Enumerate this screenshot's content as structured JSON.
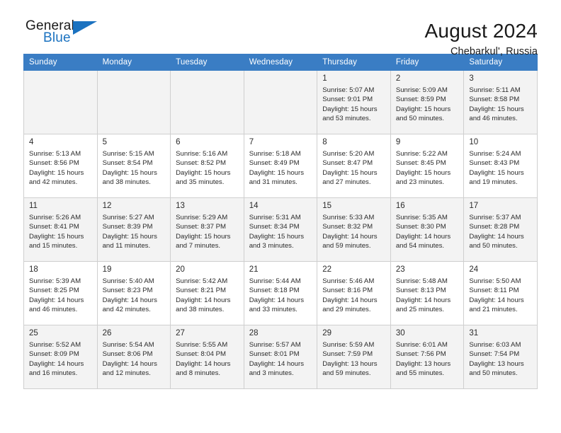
{
  "brand": {
    "name_part1": "General",
    "name_part2": "Blue",
    "accent_color": "#1b72c0"
  },
  "header": {
    "title": "August 2024",
    "subtitle": "Chebarkul', Russia"
  },
  "calendar": {
    "header_color": "#3a7dc4",
    "weekday_headers": [
      "Sunday",
      "Monday",
      "Tuesday",
      "Wednesday",
      "Thursday",
      "Friday",
      "Saturday"
    ],
    "weeks": [
      [
        {
          "day": "",
          "sunrise": "",
          "sunset": "",
          "daylight_line1": "",
          "daylight_line2": ""
        },
        {
          "day": "",
          "sunrise": "",
          "sunset": "",
          "daylight_line1": "",
          "daylight_line2": ""
        },
        {
          "day": "",
          "sunrise": "",
          "sunset": "",
          "daylight_line1": "",
          "daylight_line2": ""
        },
        {
          "day": "",
          "sunrise": "",
          "sunset": "",
          "daylight_line1": "",
          "daylight_line2": ""
        },
        {
          "day": "1",
          "sunrise": "Sunrise: 5:07 AM",
          "sunset": "Sunset: 9:01 PM",
          "daylight_line1": "Daylight: 15 hours",
          "daylight_line2": "and 53 minutes."
        },
        {
          "day": "2",
          "sunrise": "Sunrise: 5:09 AM",
          "sunset": "Sunset: 8:59 PM",
          "daylight_line1": "Daylight: 15 hours",
          "daylight_line2": "and 50 minutes."
        },
        {
          "day": "3",
          "sunrise": "Sunrise: 5:11 AM",
          "sunset": "Sunset: 8:58 PM",
          "daylight_line1": "Daylight: 15 hours",
          "daylight_line2": "and 46 minutes."
        }
      ],
      [
        {
          "day": "4",
          "sunrise": "Sunrise: 5:13 AM",
          "sunset": "Sunset: 8:56 PM",
          "daylight_line1": "Daylight: 15 hours",
          "daylight_line2": "and 42 minutes."
        },
        {
          "day": "5",
          "sunrise": "Sunrise: 5:15 AM",
          "sunset": "Sunset: 8:54 PM",
          "daylight_line1": "Daylight: 15 hours",
          "daylight_line2": "and 38 minutes."
        },
        {
          "day": "6",
          "sunrise": "Sunrise: 5:16 AM",
          "sunset": "Sunset: 8:52 PM",
          "daylight_line1": "Daylight: 15 hours",
          "daylight_line2": "and 35 minutes."
        },
        {
          "day": "7",
          "sunrise": "Sunrise: 5:18 AM",
          "sunset": "Sunset: 8:49 PM",
          "daylight_line1": "Daylight: 15 hours",
          "daylight_line2": "and 31 minutes."
        },
        {
          "day": "8",
          "sunrise": "Sunrise: 5:20 AM",
          "sunset": "Sunset: 8:47 PM",
          "daylight_line1": "Daylight: 15 hours",
          "daylight_line2": "and 27 minutes."
        },
        {
          "day": "9",
          "sunrise": "Sunrise: 5:22 AM",
          "sunset": "Sunset: 8:45 PM",
          "daylight_line1": "Daylight: 15 hours",
          "daylight_line2": "and 23 minutes."
        },
        {
          "day": "10",
          "sunrise": "Sunrise: 5:24 AM",
          "sunset": "Sunset: 8:43 PM",
          "daylight_line1": "Daylight: 15 hours",
          "daylight_line2": "and 19 minutes."
        }
      ],
      [
        {
          "day": "11",
          "sunrise": "Sunrise: 5:26 AM",
          "sunset": "Sunset: 8:41 PM",
          "daylight_line1": "Daylight: 15 hours",
          "daylight_line2": "and 15 minutes."
        },
        {
          "day": "12",
          "sunrise": "Sunrise: 5:27 AM",
          "sunset": "Sunset: 8:39 PM",
          "daylight_line1": "Daylight: 15 hours",
          "daylight_line2": "and 11 minutes."
        },
        {
          "day": "13",
          "sunrise": "Sunrise: 5:29 AM",
          "sunset": "Sunset: 8:37 PM",
          "daylight_line1": "Daylight: 15 hours",
          "daylight_line2": "and 7 minutes."
        },
        {
          "day": "14",
          "sunrise": "Sunrise: 5:31 AM",
          "sunset": "Sunset: 8:34 PM",
          "daylight_line1": "Daylight: 15 hours",
          "daylight_line2": "and 3 minutes."
        },
        {
          "day": "15",
          "sunrise": "Sunrise: 5:33 AM",
          "sunset": "Sunset: 8:32 PM",
          "daylight_line1": "Daylight: 14 hours",
          "daylight_line2": "and 59 minutes."
        },
        {
          "day": "16",
          "sunrise": "Sunrise: 5:35 AM",
          "sunset": "Sunset: 8:30 PM",
          "daylight_line1": "Daylight: 14 hours",
          "daylight_line2": "and 54 minutes."
        },
        {
          "day": "17",
          "sunrise": "Sunrise: 5:37 AM",
          "sunset": "Sunset: 8:28 PM",
          "daylight_line1": "Daylight: 14 hours",
          "daylight_line2": "and 50 minutes."
        }
      ],
      [
        {
          "day": "18",
          "sunrise": "Sunrise: 5:39 AM",
          "sunset": "Sunset: 8:25 PM",
          "daylight_line1": "Daylight: 14 hours",
          "daylight_line2": "and 46 minutes."
        },
        {
          "day": "19",
          "sunrise": "Sunrise: 5:40 AM",
          "sunset": "Sunset: 8:23 PM",
          "daylight_line1": "Daylight: 14 hours",
          "daylight_line2": "and 42 minutes."
        },
        {
          "day": "20",
          "sunrise": "Sunrise: 5:42 AM",
          "sunset": "Sunset: 8:21 PM",
          "daylight_line1": "Daylight: 14 hours",
          "daylight_line2": "and 38 minutes."
        },
        {
          "day": "21",
          "sunrise": "Sunrise: 5:44 AM",
          "sunset": "Sunset: 8:18 PM",
          "daylight_line1": "Daylight: 14 hours",
          "daylight_line2": "and 33 minutes."
        },
        {
          "day": "22",
          "sunrise": "Sunrise: 5:46 AM",
          "sunset": "Sunset: 8:16 PM",
          "daylight_line1": "Daylight: 14 hours",
          "daylight_line2": "and 29 minutes."
        },
        {
          "day": "23",
          "sunrise": "Sunrise: 5:48 AM",
          "sunset": "Sunset: 8:13 PM",
          "daylight_line1": "Daylight: 14 hours",
          "daylight_line2": "and 25 minutes."
        },
        {
          "day": "24",
          "sunrise": "Sunrise: 5:50 AM",
          "sunset": "Sunset: 8:11 PM",
          "daylight_line1": "Daylight: 14 hours",
          "daylight_line2": "and 21 minutes."
        }
      ],
      [
        {
          "day": "25",
          "sunrise": "Sunrise: 5:52 AM",
          "sunset": "Sunset: 8:09 PM",
          "daylight_line1": "Daylight: 14 hours",
          "daylight_line2": "and 16 minutes."
        },
        {
          "day": "26",
          "sunrise": "Sunrise: 5:54 AM",
          "sunset": "Sunset: 8:06 PM",
          "daylight_line1": "Daylight: 14 hours",
          "daylight_line2": "and 12 minutes."
        },
        {
          "day": "27",
          "sunrise": "Sunrise: 5:55 AM",
          "sunset": "Sunset: 8:04 PM",
          "daylight_line1": "Daylight: 14 hours",
          "daylight_line2": "and 8 minutes."
        },
        {
          "day": "28",
          "sunrise": "Sunrise: 5:57 AM",
          "sunset": "Sunset: 8:01 PM",
          "daylight_line1": "Daylight: 14 hours",
          "daylight_line2": "and 3 minutes."
        },
        {
          "day": "29",
          "sunrise": "Sunrise: 5:59 AM",
          "sunset": "Sunset: 7:59 PM",
          "daylight_line1": "Daylight: 13 hours",
          "daylight_line2": "and 59 minutes."
        },
        {
          "day": "30",
          "sunrise": "Sunrise: 6:01 AM",
          "sunset": "Sunset: 7:56 PM",
          "daylight_line1": "Daylight: 13 hours",
          "daylight_line2": "and 55 minutes."
        },
        {
          "day": "31",
          "sunrise": "Sunrise: 6:03 AM",
          "sunset": "Sunset: 7:54 PM",
          "daylight_line1": "Daylight: 13 hours",
          "daylight_line2": "and 50 minutes."
        }
      ]
    ]
  }
}
